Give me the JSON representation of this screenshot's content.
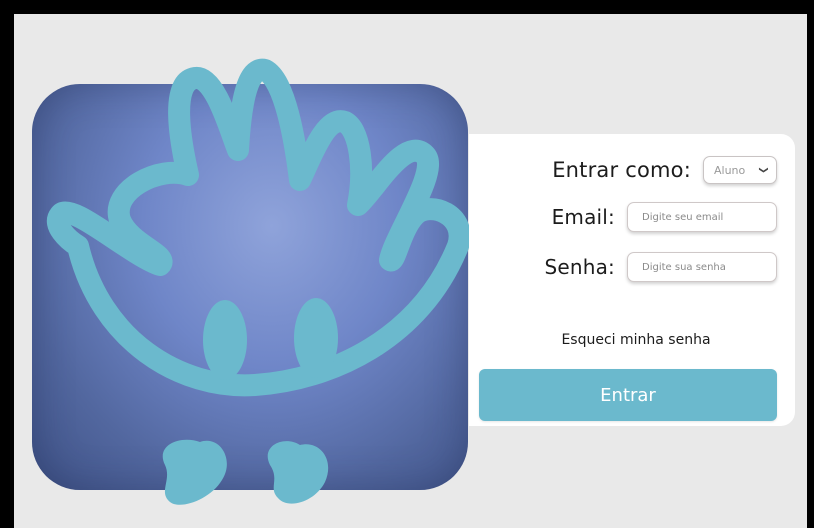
{
  "login": {
    "role_label": "Entrar como:",
    "role_value": "Aluno",
    "email_label": "Email:",
    "email_placeholder": "Digite seu email",
    "password_label": "Senha:",
    "password_placeholder": "Digite sua senha",
    "forgot_link": "Esqueci minha senha",
    "submit_label": "Entrar"
  },
  "colors": {
    "mascot": "#6bb9cd",
    "tile_light": "#8fa3da",
    "tile_dark": "#3f5286",
    "button": "#6bb9cd",
    "background": "#e9e9e9"
  },
  "icons": [
    "mascot-logo-icon",
    "chevron-down-icon"
  ]
}
